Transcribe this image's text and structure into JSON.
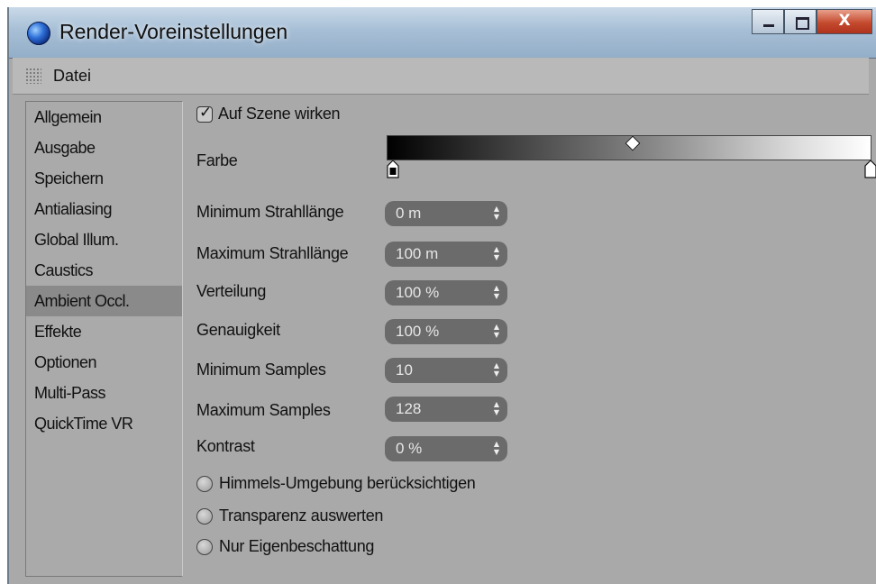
{
  "window": {
    "title": "Render-Voreinstellungen",
    "controls": {
      "minimize": "_",
      "maximize": "□",
      "close": "X"
    }
  },
  "menubar": {
    "items": [
      "Datei"
    ]
  },
  "sidebar": {
    "selected": "Ambient Occl.",
    "items": [
      "Allgemein",
      "Ausgabe",
      "Speichern",
      "Antialiasing",
      "Global Illum.",
      "Caustics",
      "Ambient Occl.",
      "Effekte",
      "Optionen",
      "Multi-Pass",
      "QuickTime VR"
    ]
  },
  "ambient_occlusion": {
    "apply_to_scene": {
      "label": "Auf Szene wirken",
      "checked": true
    },
    "color": {
      "label": "Farbe",
      "gradient_from": "#000000",
      "gradient_to": "#ffffff"
    },
    "params": [
      {
        "label": "Minimum Strahllänge",
        "value": "0 m"
      },
      {
        "label": "Maximum Strahllänge",
        "value": "100 m"
      },
      {
        "label": "Verteilung",
        "value": "100 %"
      },
      {
        "label": "Genauigkeit",
        "value": "100 %"
      },
      {
        "label": "Minimum Samples",
        "value": "10"
      },
      {
        "label": "Maximum Samples",
        "value": "128"
      },
      {
        "label": "Kontrast",
        "value": "0 %"
      }
    ],
    "options": [
      {
        "label": "Himmels-Umgebung berücksichtigen",
        "checked": false
      },
      {
        "label": "Transparenz auswerten",
        "checked": false
      },
      {
        "label": "Nur Eigenbeschattung",
        "checked": false
      }
    ]
  }
}
